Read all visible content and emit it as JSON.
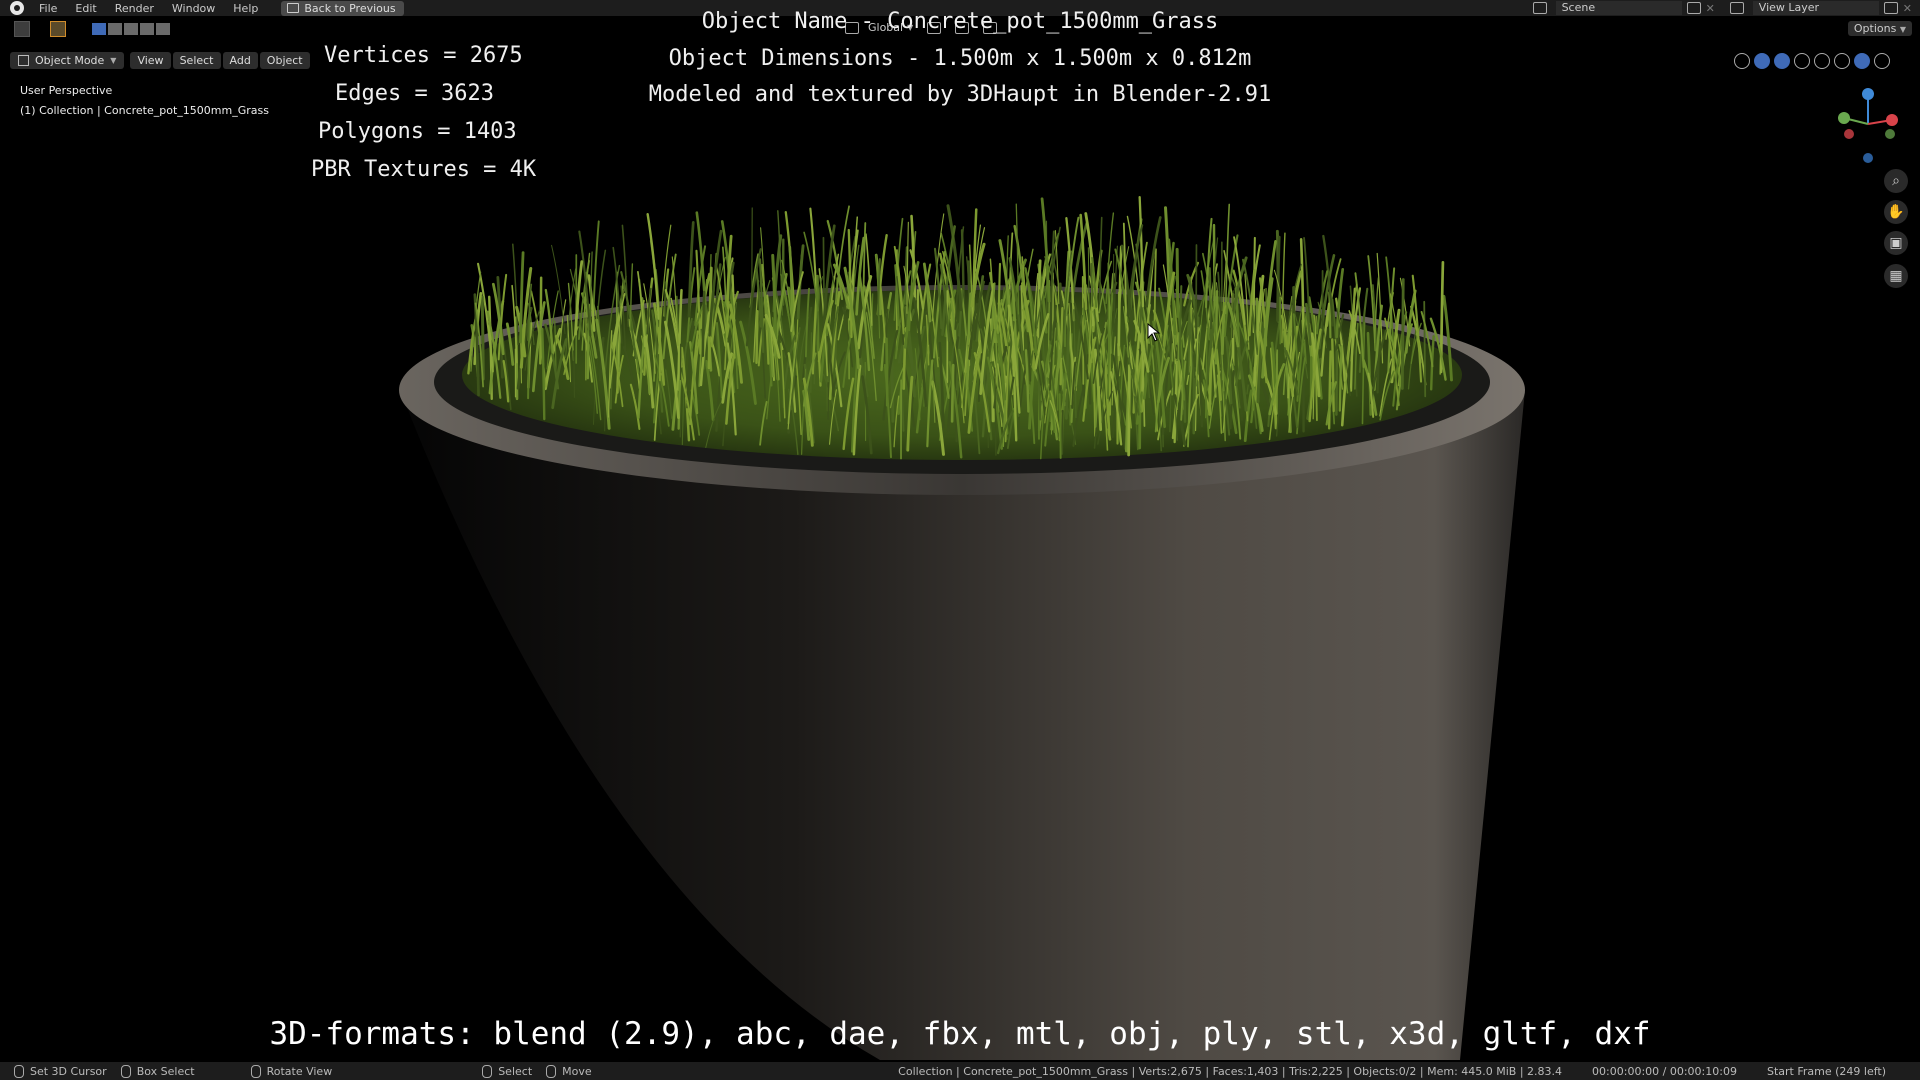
{
  "menu": {
    "items": [
      "File",
      "Edit",
      "Render",
      "Window",
      "Help"
    ],
    "back_label": "Back to Previous"
  },
  "topright": {
    "scene": "Scene",
    "view_layer": "View Layer"
  },
  "toolbar": {
    "transform_orientation": "Global",
    "options_label": "Options"
  },
  "header": {
    "mode": "Object Mode",
    "buttons": [
      "View",
      "Select",
      "Add",
      "Object"
    ]
  },
  "viewport": {
    "perspective": "User Perspective",
    "collection": "(1) Collection | Concrete_pot_1500mm_Grass",
    "stats": {
      "vertices": "Vertices = 2675",
      "edges": "Edges = 3623",
      "polygons": "Polygons = 1403",
      "textures": "PBR Textures = 4K"
    },
    "object_name": "Object Name - Concrete_pot_1500mm_Grass",
    "dimensions": "Object Dimensions -  1.500m x 1.500m x 0.812m",
    "credits": "Modeled and textured by 3DHaupt in Blender-2.91",
    "formats": "3D-formats: blend (2.9), abc, dae, fbx, mtl, obj, ply, stl, x3d, gltf, dxf"
  },
  "statusbar": {
    "left": [
      "Set 3D Cursor",
      "Box Select",
      "Rotate View",
      "Select",
      "Move"
    ],
    "info": "Collection | Concrete_pot_1500mm_Grass | Verts:2,675 | Faces:1,403 | Tris:2,225 | Objects:0/2 | Mem: 445.0 MiB | 2.83.4",
    "time": "00:00:00:00 / 00:00:10:09",
    "frame": "Start Frame (249 left)"
  },
  "colors": {
    "accent": "#3f6ab7",
    "grass": "#5a7a2a",
    "concrete": "#4a4642"
  }
}
